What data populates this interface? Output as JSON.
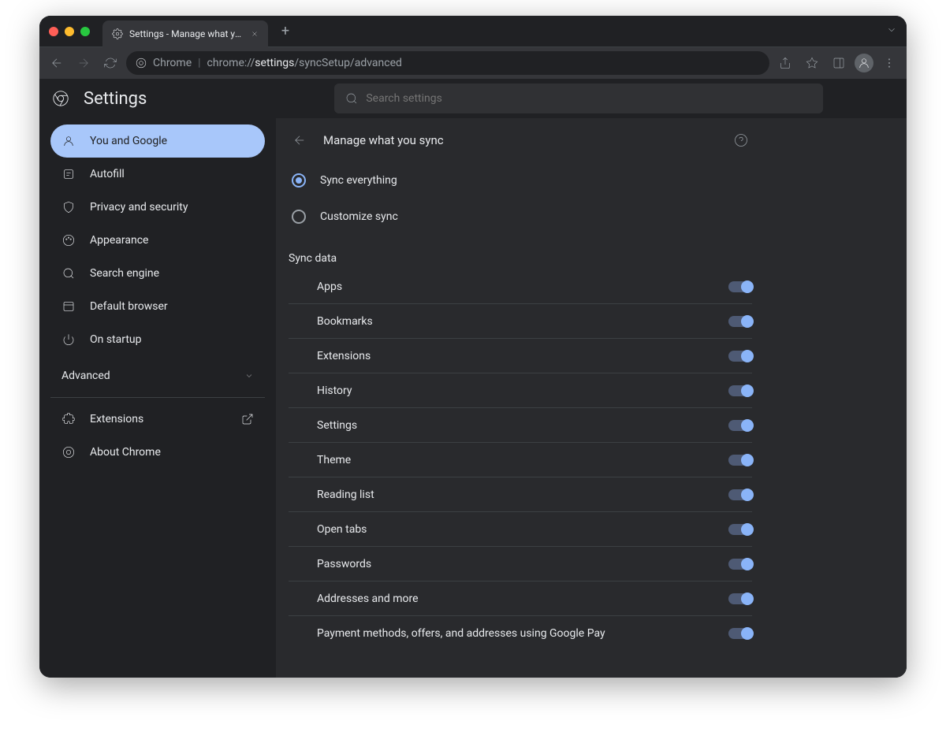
{
  "window": {
    "tab_title": "Settings - Manage what you sy"
  },
  "url": {
    "host": "Chrome",
    "scheme": "chrome://",
    "path_main": "settings",
    "path_rest": "/syncSetup/advanced"
  },
  "app": {
    "title": "Settings",
    "search_placeholder": "Search settings"
  },
  "sidebar": {
    "items": [
      {
        "id": "you-and-google",
        "label": "You and Google",
        "active": true
      },
      {
        "id": "autofill",
        "label": "Autofill"
      },
      {
        "id": "privacy",
        "label": "Privacy and security"
      },
      {
        "id": "appearance",
        "label": "Appearance"
      },
      {
        "id": "search-engine",
        "label": "Search engine"
      },
      {
        "id": "default-browser",
        "label": "Default browser"
      },
      {
        "id": "on-startup",
        "label": "On startup"
      }
    ],
    "advanced_label": "Advanced",
    "extensions_label": "Extensions",
    "about_label": "About Chrome"
  },
  "page": {
    "title": "Manage what you sync",
    "radio": {
      "sync_everything": "Sync everything",
      "customize": "Customize sync",
      "selected": "sync_everything"
    },
    "section_label": "Sync data",
    "data_items": [
      {
        "label": "Apps",
        "on": true
      },
      {
        "label": "Bookmarks",
        "on": true
      },
      {
        "label": "Extensions",
        "on": true
      },
      {
        "label": "History",
        "on": true
      },
      {
        "label": "Settings",
        "on": true
      },
      {
        "label": "Theme",
        "on": true
      },
      {
        "label": "Reading list",
        "on": true
      },
      {
        "label": "Open tabs",
        "on": true
      },
      {
        "label": "Passwords",
        "on": true
      },
      {
        "label": "Addresses and more",
        "on": true
      },
      {
        "label": "Payment methods, offers, and addresses using Google Pay",
        "on": true
      }
    ]
  }
}
